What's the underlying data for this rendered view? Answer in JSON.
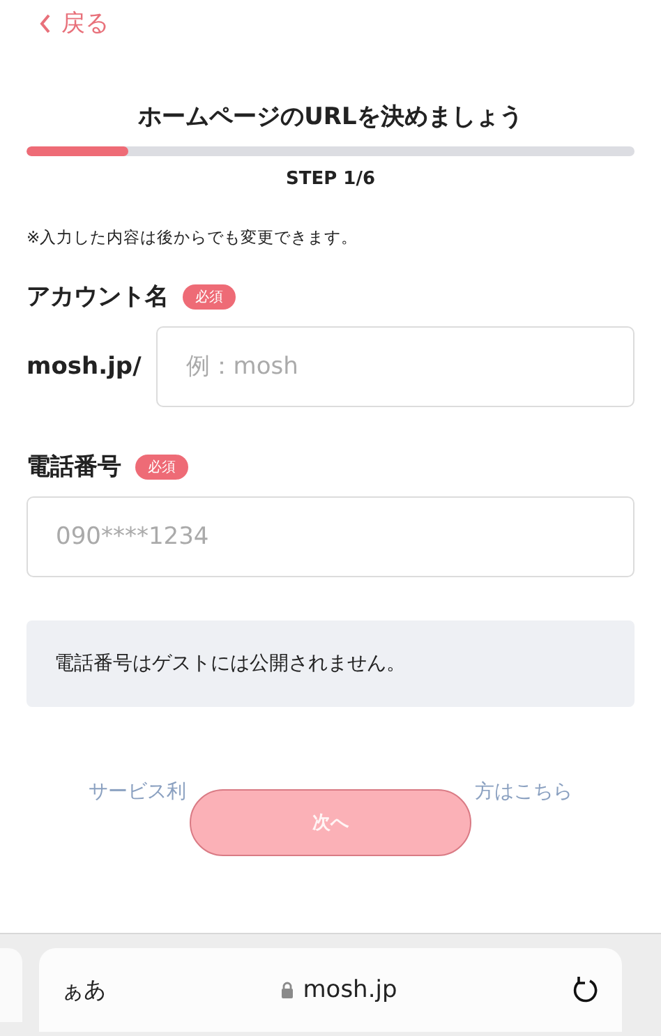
{
  "back": {
    "label": "戻る"
  },
  "title": "ホームページのURLを決めましょう",
  "progress": {
    "level": 0.167,
    "label": "STEP 1/6"
  },
  "note": "※入力した内容は後からでも変更できます。",
  "fields": [
    {
      "label": "アカウント名",
      "badge": "必須",
      "prefix": "mosh.jp/",
      "placeholder": "例：mosh"
    },
    {
      "label": "電話番号",
      "badge": "必須",
      "placeholder": "090****1234"
    }
  ],
  "info": "電話番号はゲストには公開されません。",
  "link_fragments": [
    "サービス利",
    "方はこちら"
  ],
  "next_button": {
    "label": "次へ",
    "disabled": true
  },
  "browser": {
    "text_size": "ぁあ",
    "url": "mosh.jp"
  }
}
